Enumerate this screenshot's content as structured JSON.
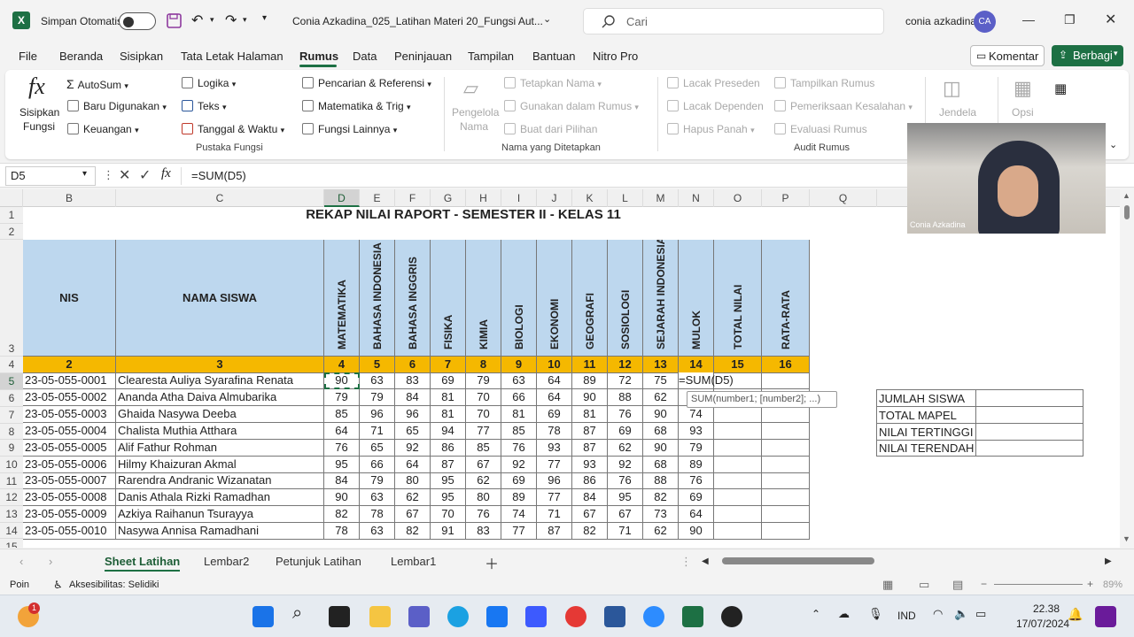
{
  "titlebar": {
    "autosave_label": "Simpan Otomatis",
    "file_title": "Conia Azkadina_025_Latihan Materi 20_Fungsi Aut...",
    "search_placeholder": "Cari",
    "user_name": "conia azkadina",
    "user_initials": "CA"
  },
  "menu": {
    "items": [
      "File",
      "Beranda",
      "Sisipkan",
      "Tata Letak Halaman",
      "Rumus",
      "Data",
      "Peninjauan",
      "Tampilan",
      "Bantuan",
      "Nitro Pro"
    ],
    "active": "Rumus",
    "komentar": "Komentar",
    "berbagi": "Berbagi"
  },
  "ribbon": {
    "insert_function": [
      "Sisipkan",
      "Fungsi"
    ],
    "library": {
      "autosum": "AutoSum",
      "recent": "Baru Digunakan",
      "financial": "Keuangan",
      "logical": "Logika",
      "text": "Teks",
      "datetime": "Tanggal & Waktu",
      "lookup": "Pencarian & Referensi",
      "math": "Matematika & Trig",
      "more": "Fungsi Lainnya",
      "group": "Pustaka Fungsi"
    },
    "names": {
      "manager": [
        "Pengelola",
        "Nama"
      ],
      "define": "Tetapkan Nama",
      "use": "Gunakan dalam Rumus",
      "create": "Buat dari Pilihan",
      "group": "Nama yang Ditetapkan"
    },
    "audit": {
      "precedents": "Lacak Preseden",
      "dependents": "Lacak Dependen",
      "remove": "Hapus Panah",
      "show": "Tampilkan Rumus",
      "errors": "Pemeriksaan Kesalahan",
      "evaluate": "Evaluasi Rumus",
      "group": "Audit Rumus",
      "watch": "Jendela",
      "options": "Opsi"
    }
  },
  "formula_bar": {
    "name_box": "D5",
    "formula": "=SUM(D5)"
  },
  "sheet": {
    "columns": [
      "B",
      "C",
      "D",
      "E",
      "F",
      "G",
      "H",
      "I",
      "J",
      "K",
      "L",
      "M",
      "N",
      "O",
      "P",
      "Q"
    ],
    "rows": [
      "1",
      "2",
      "3",
      "4",
      "5",
      "6",
      "7",
      "8",
      "9",
      "10",
      "11",
      "12",
      "13",
      "14",
      "15"
    ],
    "title": "REKAP NILAI RAPORT - SEMESTER II - KELAS 11",
    "header_nis": "NIS",
    "header_nama": "NAMA SISWA",
    "subjects": [
      "MATEMATIKA",
      "BAHASA INDONESIA",
      "BAHASA INGGRIS",
      "FISIKA",
      "KIMIA",
      "BIOLOGI",
      "EKONOMI",
      "GEOGRAFI",
      "SOSIOLOGI",
      "SEJARAH INDONESIA",
      "MULOK",
      "TOTAL NILAI",
      "RATA-RATA"
    ],
    "numbers": [
      "2",
      "3",
      "4",
      "5",
      "6",
      "7",
      "8",
      "9",
      "10",
      "11",
      "12",
      "13",
      "14",
      "15",
      "16"
    ],
    "students": [
      {
        "nis": "23-05-055-0001",
        "name": "Clearesta Auliya Syarafina Renata",
        "scores": [
          "90",
          "63",
          "83",
          "69",
          "79",
          "63",
          "64",
          "89",
          "72",
          "75"
        ],
        "mulok": "=SUM(D5)"
      },
      {
        "nis": "23-05-055-0002",
        "name": "Ananda Atha Daiva Almubarika",
        "scores": [
          "79",
          "79",
          "84",
          "81",
          "70",
          "66",
          "64",
          "90",
          "88",
          "62"
        ],
        "mulok": ""
      },
      {
        "nis": "23-05-055-0003",
        "name": "Ghaida Nasywa Deeba",
        "scores": [
          "85",
          "96",
          "96",
          "81",
          "70",
          "81",
          "69",
          "81",
          "76",
          "90"
        ],
        "mulok": "74"
      },
      {
        "nis": "23-05-055-0004",
        "name": "Chalista Muthia Atthara",
        "scores": [
          "64",
          "71",
          "65",
          "94",
          "77",
          "85",
          "78",
          "87",
          "69",
          "68"
        ],
        "mulok": "93"
      },
      {
        "nis": "23-05-055-0005",
        "name": "Alif Fathur Rohman",
        "scores": [
          "76",
          "65",
          "92",
          "86",
          "85",
          "76",
          "93",
          "87",
          "62",
          "90"
        ],
        "mulok": "79"
      },
      {
        "nis": "23-05-055-0006",
        "name": "Hilmy Khaizuran Akmal",
        "scores": [
          "95",
          "66",
          "64",
          "87",
          "67",
          "92",
          "77",
          "93",
          "92",
          "68"
        ],
        "mulok": "89"
      },
      {
        "nis": "23-05-055-0007",
        "name": "Rarendra Andranic Wizanatan",
        "scores": [
          "84",
          "79",
          "80",
          "95",
          "62",
          "69",
          "96",
          "86",
          "76",
          "88"
        ],
        "mulok": "76"
      },
      {
        "nis": "23-05-055-0008",
        "name": "Danis Athala Rizki Ramadhan",
        "scores": [
          "90",
          "63",
          "62",
          "95",
          "80",
          "89",
          "77",
          "84",
          "95",
          "82"
        ],
        "mulok": "69"
      },
      {
        "nis": "23-05-055-0009",
        "name": "Azkiya Raihanun Tsurayya",
        "scores": [
          "82",
          "78",
          "67",
          "70",
          "76",
          "74",
          "71",
          "67",
          "67",
          "73"
        ],
        "mulok": "64"
      },
      {
        "nis": "23-05-055-0010",
        "name": "Nasywa Annisa Ramadhani",
        "scores": [
          "78",
          "63",
          "82",
          "91",
          "83",
          "77",
          "87",
          "82",
          "71",
          "62"
        ],
        "mulok": "90"
      }
    ],
    "tooltip": "SUM(number1; [number2]; ...)",
    "summary": [
      "JUMLAH SISWA",
      "TOTAL MAPEL",
      "NILAI TERTINGGI",
      "NILAI TERENDAH"
    ]
  },
  "camera_label": "Conia Azkadina",
  "tabs": [
    "Sheet Latihan",
    "Lembar2",
    "Petunjuk Latihan",
    "Lembar1"
  ],
  "active_tab": "Sheet Latihan",
  "status": {
    "mode": "Poin",
    "accessibility": "Aksesibilitas: Selidiki",
    "zoom": "89%"
  },
  "taskbar": {
    "language": "IND",
    "time": "22.38",
    "date": "17/07/2024",
    "badge": "1"
  },
  "colors": {
    "excel_green": "#1d7044",
    "header_blue": "#bdd7ee",
    "header_gold": "#f5b800"
  }
}
